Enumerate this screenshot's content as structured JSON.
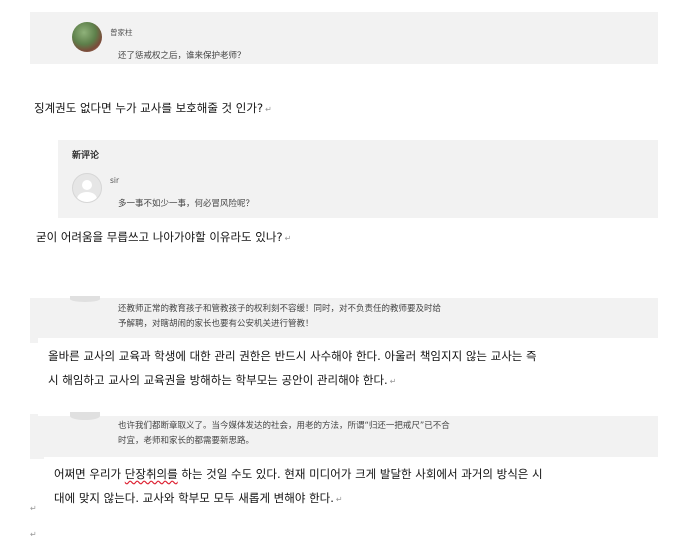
{
  "thread": {
    "comment1": {
      "user": "曾家柱",
      "text": "还了惩戒权之后，谁来保护老师？",
      "translation": "징계권도 없다면 누가 교사를 보호해줄 것 인가?"
    },
    "new_comments_label": "新评论",
    "comment2": {
      "user": "sir",
      "text": "多一事不如少一事，何必冒风险呢？",
      "translation": "굳이 어려움을 무릅쓰고 나아가야할 이유라도 있나?"
    },
    "comment3": {
      "text_line1": "还教师正常的教育孩子和管教孩子的权利刻不容缓！同时，对不负责任的教师要及时给",
      "text_line2": "予解聘，对瞎胡闹的家长也要有公安机关进行管教！",
      "translation_line1": "올바른 교사의 교육과 학생에 대한 관리 권한은 반드시 사수해야 한다. 아울러 책임지지 않는 교사는 즉",
      "translation_line2": "시 해임하고 교사의 교육권을 방해하는 학부모는 공안이 관리해야 한다."
    },
    "comment4": {
      "text_line1": "也许我们都断章取义了。当今媒体发达的社会，用老的方法，所谓“归还一把戒尺”已不合",
      "text_line2": "时宜，老师和家长的都需要新思路。",
      "translation_line1_a": "어쩌면 우리가 ",
      "translation_line1_b": "단장취의를",
      "translation_line1_c": " 하는 것일 수도 있다. 현재 미디어가 크게 발달한 사회에서 과거의 방식은 시",
      "translation_line2": "대에 맞지 않는다. 교사와 학부모 모두 새롭게 변해야 한다."
    },
    "paragraph_mark": "↵"
  },
  "colors": {
    "panel_gray": "#f2f2f2",
    "text_dark": "#111111",
    "text_meta": "#555555",
    "spellcheck_red": "#dd2233"
  }
}
